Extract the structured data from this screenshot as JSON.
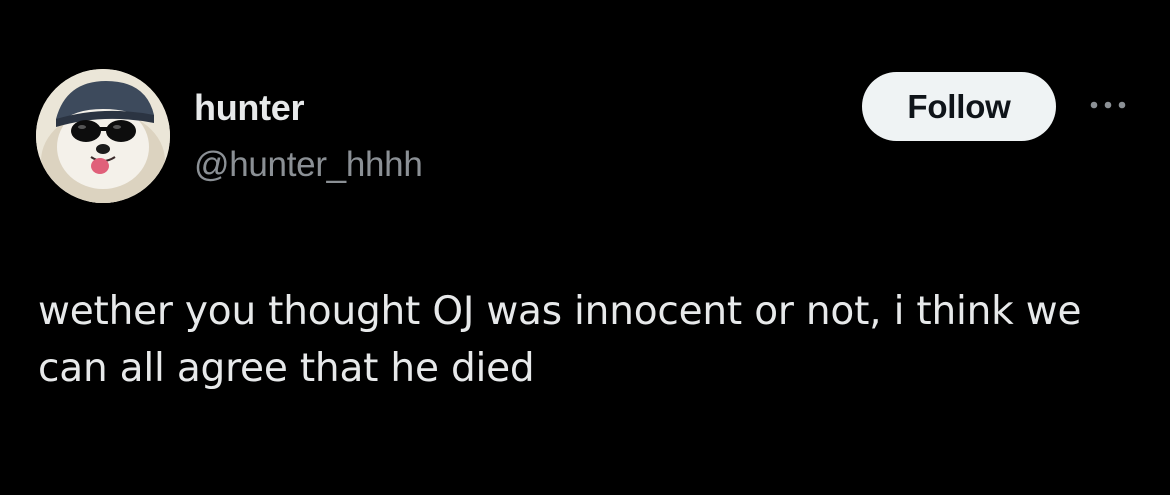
{
  "author": {
    "display_name": "hunter",
    "handle": "@hunter_hhhh",
    "avatar_icon": "dog-with-sunglasses-avatar"
  },
  "actions": {
    "follow_label": "Follow",
    "more_icon": "ellipsis-icon"
  },
  "tweet": {
    "text": "wether you thought OJ was innocent or not, i think we can all agree that he died"
  },
  "colors": {
    "background": "#000000",
    "primary_text": "#e7e9ea",
    "secondary_text": "#8b9095",
    "follow_bg": "#eff3f4",
    "follow_text": "#0f1419"
  }
}
